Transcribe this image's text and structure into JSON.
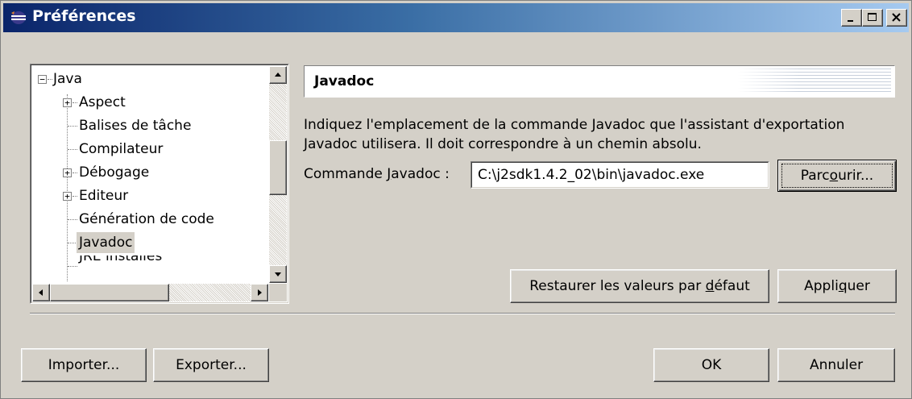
{
  "window": {
    "title": "Préférences",
    "controls": [
      "minimize",
      "maximize",
      "close"
    ]
  },
  "tree": {
    "items": [
      {
        "label": "Java",
        "indent": 0,
        "expander": "−"
      },
      {
        "label": "Aspect",
        "indent": 1,
        "expander": "+"
      },
      {
        "label": "Balises de tâche",
        "indent": 1,
        "expander": ""
      },
      {
        "label": "Compilateur",
        "indent": 1,
        "expander": ""
      },
      {
        "label": "Débogage",
        "indent": 1,
        "expander": "+"
      },
      {
        "label": "Editeur",
        "indent": 1,
        "expander": "+"
      },
      {
        "label": "Génération de code",
        "indent": 1,
        "expander": ""
      },
      {
        "label": "Javadoc",
        "indent": 1,
        "expander": "",
        "selected": true
      },
      {
        "label": "JRE installés",
        "indent": 1,
        "expander": ""
      }
    ]
  },
  "page": {
    "title": "Javadoc",
    "description": "Indiquez l'emplacement de la commande Javadoc que l'assistant d'exportation Javadoc utilisera. Il doit correspondre à un chemin absolu.",
    "field_label_pre": "Commande ",
    "field_label_mnemonic": "J",
    "field_label_post": "avadoc :",
    "field_value": "C:\\j2sdk1.4.2_02\\bin\\javadoc.exe",
    "browse_pre": "Parc",
    "browse_mnemonic": "o",
    "browse_post": "urir...",
    "restore_pre": "Restaurer les valeurs par ",
    "restore_mnemonic": "d",
    "restore_post": "éfaut",
    "apply_pre": "Appli",
    "apply_mnemonic": "q",
    "apply_post": "uer"
  },
  "footer": {
    "import_label": "Importer...",
    "export_label": "Exporter...",
    "ok_label": "OK",
    "cancel_label": "Annuler"
  }
}
